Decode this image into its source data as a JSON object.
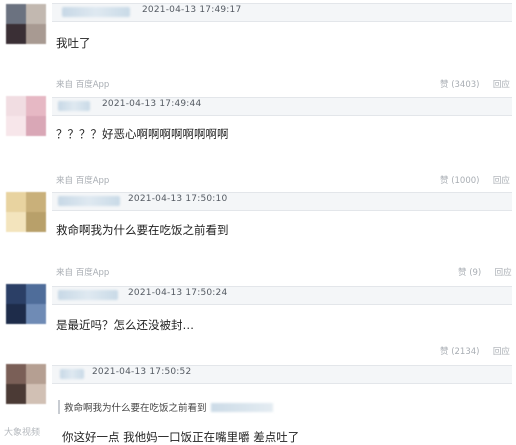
{
  "colors": {
    "header_bg": "#f4f6f8",
    "text": "#222222",
    "meta_text": "#a8adb3",
    "username_blur": "#c7d8e6"
  },
  "comments": [
    {
      "timestamp": "2021-04-13 17:49:17",
      "text": "我吐了",
      "avatar_icon": "blurred-avatar",
      "avatar_colors": [
        "#6b7280",
        "#c2b8b0",
        "#3a2f35",
        "#a89a92"
      ]
    },
    {
      "meta": "来自 百度App",
      "like_label": "赞 (3403)",
      "reply_label": "回应",
      "timestamp": "2021-04-13 17:49:44",
      "text": "？？？？好恶心啊啊啊啊啊啊啊啊",
      "avatar_icon": "blurred-avatar",
      "avatar_colors": [
        "#f1dde2",
        "#e6b8c4",
        "#f7e6ea",
        "#d9a7b6"
      ]
    },
    {
      "meta": "来自 百度App",
      "like_label": "赞 (1000)",
      "reply_label": "回应",
      "timestamp": "2021-04-13 17:50:10",
      "text": "救命啊我为什么要在吃饭之前看到",
      "avatar_icon": "blurred-avatar",
      "avatar_colors": [
        "#e8d3a0",
        "#c9b07a",
        "#f3e4bd",
        "#b8a06a"
      ]
    },
    {
      "meta": "来自 百度App",
      "like_label": "赞 (9)",
      "reply_label": "回应",
      "timestamp": "2021-04-13 17:50:24",
      "text": "是最近吗？怎么还没被封…",
      "avatar_icon": "blurred-avatar",
      "avatar_colors": [
        "#2b3f66",
        "#4f6d9a",
        "#1e2c4a",
        "#6f8bb5"
      ]
    },
    {
      "like_label": "赞 (2134)",
      "reply_label": "回应",
      "timestamp": "2021-04-13 17:50:52",
      "quote": "救命啊我为什么要在吃饭之前看到",
      "text": "你这好一点 我他妈一口饭正在嘴里嚼 差点吐了",
      "avatar_icon": "blurred-avatar",
      "avatar_colors": [
        "#7a5f57",
        "#b59f92",
        "#4b3a35",
        "#d1c0b4"
      ]
    }
  ],
  "watermark": "大象视频"
}
